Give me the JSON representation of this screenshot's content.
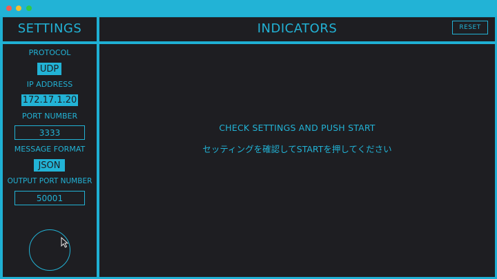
{
  "titlebar": {
    "buttons": [
      "close",
      "minimize",
      "maximize"
    ]
  },
  "settings": {
    "title": "SETTINGS",
    "protocol_label": "PROTOCOL",
    "protocol_value": "UDP",
    "ip_label": "IP ADDRESS",
    "ip_value": "172.17.1.20",
    "port_label": "PORT NUMBER",
    "port_value": "3333",
    "format_label": "MESSAGE FORMAT",
    "format_value": "JSON",
    "output_port_label": "OUTPUT PORT NUMBER",
    "output_port_value": "50001"
  },
  "indicators": {
    "title": "INDICATORS",
    "reset_label": "RESET",
    "message_en": "CHECK SETTINGS AND PUSH START",
    "message_ja": "セッティングを確認してSTARTを押してください"
  },
  "colors": {
    "accent": "#22b3d6",
    "background": "#1e1e22",
    "close": "#f15d52",
    "minimize": "#f6be2f",
    "maximize": "#33c748"
  }
}
